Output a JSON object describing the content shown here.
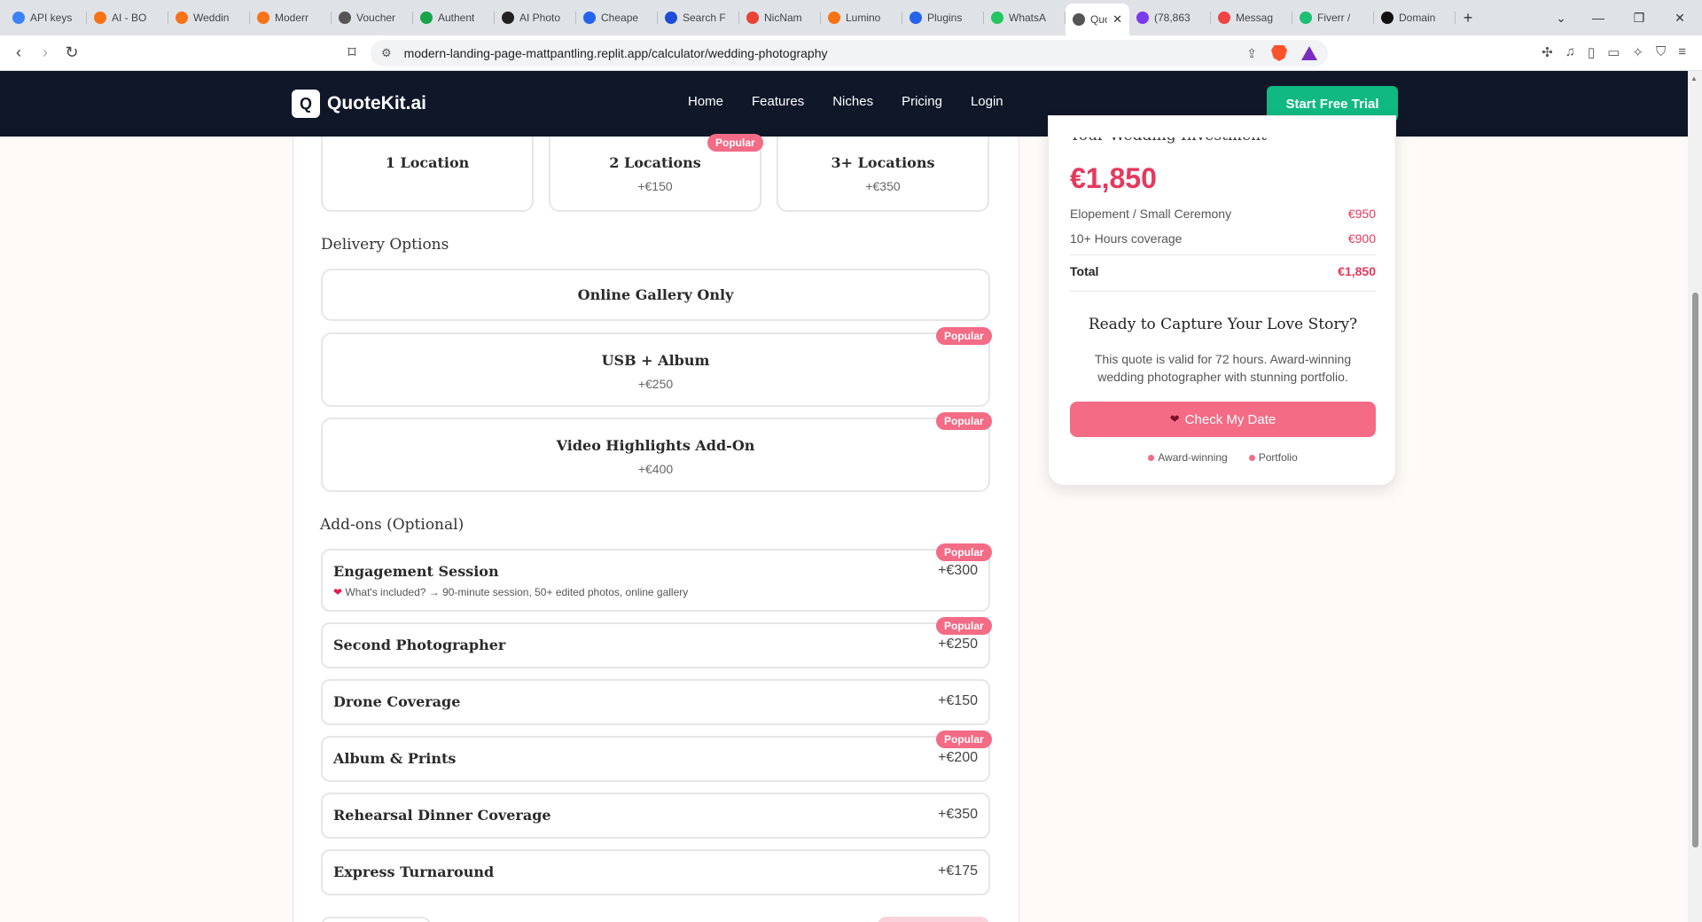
{
  "browser": {
    "tabs": [
      {
        "label": "API keys",
        "color": "#3b82f6"
      },
      {
        "label": "AI - BO",
        "color": "#f97316"
      },
      {
        "label": "Weddin",
        "color": "#f97316"
      },
      {
        "label": "Moderr",
        "color": "#f97316"
      },
      {
        "label": "Voucher",
        "color": "#555555"
      },
      {
        "label": "Authent",
        "color": "#16a34a"
      },
      {
        "label": "AI Photo",
        "color": "#222222"
      },
      {
        "label": "Cheape",
        "color": "#2563eb"
      },
      {
        "label": "Search F",
        "color": "#1d4ed8"
      },
      {
        "label": "NicNam",
        "color": "#ea4335"
      },
      {
        "label": "Lumino",
        "color": "#f97316"
      },
      {
        "label": "Plugins",
        "color": "#2563eb"
      },
      {
        "label": "WhatsA",
        "color": "#22c55e"
      }
    ],
    "active_tab": {
      "label": "Quo",
      "close": "✕"
    },
    "tabs_after": [
      {
        "label": "(78,863",
        "color": "#7c3aed"
      },
      {
        "label": "Messag",
        "color": "#ef4444"
      },
      {
        "label": "Fiverr /",
        "color": "#1dbf73"
      },
      {
        "label": "Domain",
        "color": "#111111"
      }
    ],
    "new_tab": "+",
    "url": "modern-landing-page-mattpantling.replit.app/calculator/wedding-photography"
  },
  "header": {
    "logo_letter": "Q",
    "logo_text": "QuoteKit.ai",
    "nav": [
      "Home",
      "Features",
      "Niches",
      "Pricing",
      "Login"
    ],
    "cta": "Start Free Trial"
  },
  "locations": [
    {
      "title": "1 Location",
      "price": ""
    },
    {
      "title": "2 Locations",
      "price": "+€150",
      "badge": "Popular"
    },
    {
      "title": "3+ Locations",
      "price": "+€350"
    }
  ],
  "delivery": {
    "title": "Delivery Options",
    "options": [
      {
        "title": "Online Gallery Only",
        "price": ""
      },
      {
        "title": "USB + Album",
        "price": "+€250",
        "badge": "Popular"
      },
      {
        "title": "Video Highlights Add-On",
        "price": "+€400",
        "badge": "Popular"
      }
    ]
  },
  "addons": {
    "title": "Add-ons (Optional)",
    "items": [
      {
        "name": "Engagement Session",
        "price": "+€300",
        "badge": "Popular",
        "sub": "What's included? → 90-minute session, 50+ edited photos, online gallery"
      },
      {
        "name": "Second Photographer",
        "price": "+€250",
        "badge": "Popular"
      },
      {
        "name": "Drone Coverage",
        "price": "+€150"
      },
      {
        "name": "Album & Prints",
        "price": "+€200",
        "badge": "Popular"
      },
      {
        "name": "Rehearsal Dinner Coverage",
        "price": "+€350"
      },
      {
        "name": "Express Turnaround",
        "price": "+€175"
      }
    ]
  },
  "summary": {
    "title": "Your Wedding Investment",
    "total_big": "€1,850",
    "lines": [
      {
        "label": "Elopement / Small Ceremony",
        "value": "€950"
      },
      {
        "label": "10+ Hours coverage",
        "value": "€900"
      }
    ],
    "total_label": "Total",
    "total_value": "€1,850",
    "ready_title": "Ready to Capture Your Love Story?",
    "note": "This quote is valid for 72 hours. Award-winning wedding photographer with stunning portfolio.",
    "button": "Check My Date",
    "footer": [
      "Award-winning",
      "Portfolio"
    ]
  }
}
